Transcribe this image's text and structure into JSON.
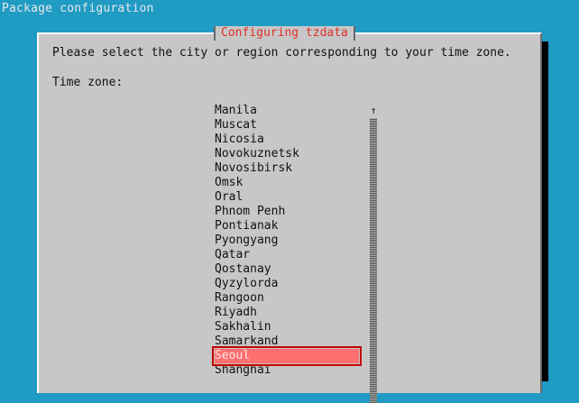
{
  "screen": {
    "title": "Package configuration"
  },
  "dialog": {
    "title": "Configuring tzdata",
    "prompt": "Please select the city or region corresponding to your time zone.",
    "field_label": "Time zone:",
    "scroll_up_glyph": "↑",
    "timezones": [
      "Manila",
      "Muscat",
      "Nicosia",
      "Novokuznetsk",
      "Novosibirsk",
      "Omsk",
      "Oral",
      "Phnom Penh",
      "Pontianak",
      "Pyongyang",
      "Qatar",
      "Qostanay",
      "Qyzylorda",
      "Rangoon",
      "Riyadh",
      "Sakhalin",
      "Samarkand",
      "Seoul",
      "Shanghai"
    ],
    "selected": "Seoul"
  },
  "colors": {
    "background": "#1f9bc4",
    "dialog_bg": "#c7c7c7",
    "title_text": "#e0302a",
    "selection_bg": "#ff6f6f",
    "selection_border": "#c30000"
  }
}
